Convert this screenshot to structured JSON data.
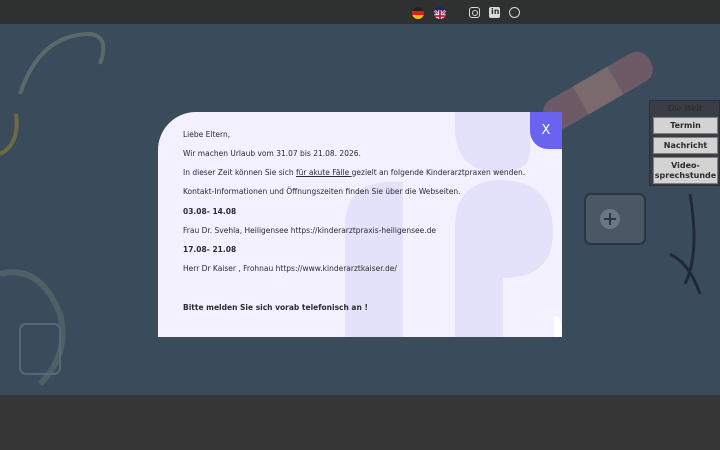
{
  "header": {
    "languages": [
      {
        "name": "german",
        "icon": "flag-de-icon"
      },
      {
        "name": "english",
        "icon": "flag-uk-icon"
      }
    ],
    "social": [
      "instagram-icon",
      "linkedin-icon",
      "whatsapp-icon"
    ],
    "linkedin_glyph": "in"
  },
  "side_menu": {
    "title": "Die Welt",
    "buttons": [
      "Termin",
      "Nachricht",
      "Video-\nsprechstunde"
    ]
  },
  "modal": {
    "close_label": "X",
    "greeting": "Liebe Eltern,",
    "vacation": "Wir machen Urlaub vom 31.07 bis 21.08. 2026.",
    "line3_pre": "In dieser Zeit können Sie sich ",
    "line3_link": "für akute Fälle ",
    "line3_post": " gezielt an folgende Kinderarztpraxen wenden.",
    "contact_info": "Kontakt-Informationen und Öffnungszeiten finden Sie über die Webseiten.",
    "period1": "03.08- 14.08",
    "doctor1": "Frau Dr. Svehla, Heiligensee https://kinderarztpraxis-heiligensee.de",
    "period2": "17.08- 21.08",
    "doctor2": "Herr Dr Kaiser , Frohnau  https://www.kinderarztkaiser.de/",
    "notice": "Bitte melden Sie sich vorab telefonisch an !"
  },
  "colors": {
    "accent": "#6a63ef",
    "modal_bg": "#f3f1ff",
    "topbar": "#2f3030"
  }
}
